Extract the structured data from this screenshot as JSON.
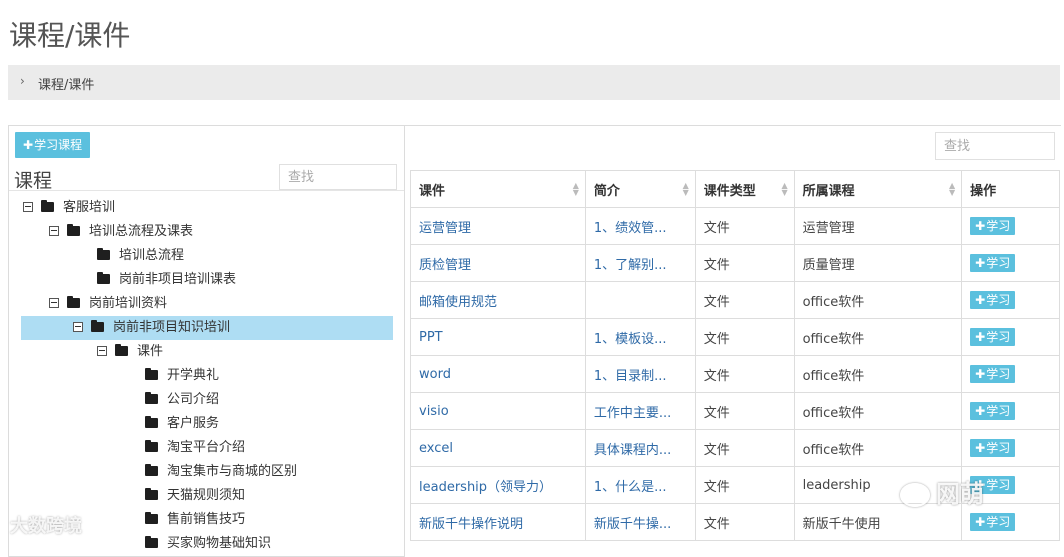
{
  "page_title": "课程/课件",
  "breadcrumb": {
    "chevron": "›",
    "text": "课程/课件"
  },
  "left_panel": {
    "add_button": "学习课程",
    "heading": "课程",
    "search_placeholder": "查找",
    "tree": [
      {
        "label": "客服培训",
        "expanded": true
      },
      {
        "label": "培训总流程及课表",
        "expanded": true
      },
      {
        "label": "培训总流程"
      },
      {
        "label": "岗前非项目培训课表"
      },
      {
        "label": "岗前培训资料",
        "expanded": true
      },
      {
        "label": "岗前非项目知识培训",
        "expanded": true,
        "selected": true
      },
      {
        "label": "课件",
        "expanded": true
      },
      {
        "label": "开学典礼"
      },
      {
        "label": "公司介绍"
      },
      {
        "label": "客户服务"
      },
      {
        "label": "淘宝平台介绍"
      },
      {
        "label": "淘宝集市与商城的区别"
      },
      {
        "label": "天猫规则须知"
      },
      {
        "label": "售前销售技巧"
      },
      {
        "label": "买家购物基础知识"
      }
    ]
  },
  "right_panel": {
    "search_placeholder": "查找",
    "columns": [
      "课件",
      "简介",
      "课件类型",
      "所属课程",
      "操作"
    ],
    "action_label": "学习",
    "rows": [
      {
        "name": "运营管理",
        "intro": "1、绩效管...",
        "type": "文件",
        "course": "运营管理"
      },
      {
        "name": "质检管理",
        "intro": "1、了解别...",
        "type": "文件",
        "course": "质量管理"
      },
      {
        "name": "邮箱使用规范",
        "intro": "",
        "type": "文件",
        "course": "office软件"
      },
      {
        "name": "PPT",
        "intro": "1、模板设...",
        "type": "文件",
        "course": "office软件"
      },
      {
        "name": "word",
        "intro": "1、目录制...",
        "type": "文件",
        "course": "office软件"
      },
      {
        "name": "visio",
        "intro": "工作中主要...",
        "type": "文件",
        "course": "office软件"
      },
      {
        "name": "excel",
        "intro": "具体课程内...",
        "type": "文件",
        "course": "office软件"
      },
      {
        "name": "leadership（领导力）",
        "intro": "1、什么是...",
        "type": "文件",
        "course": "leadership"
      },
      {
        "name": "新版千牛操作说明",
        "intro": "新版千牛操...",
        "type": "文件",
        "course": "新版千牛使用"
      }
    ]
  },
  "watermarks": {
    "left": "大数跨境",
    "right": "网萌"
  },
  "colors": {
    "accent": "#5bc0de",
    "link": "#2f6aa7",
    "selected": "#aeddf3"
  }
}
